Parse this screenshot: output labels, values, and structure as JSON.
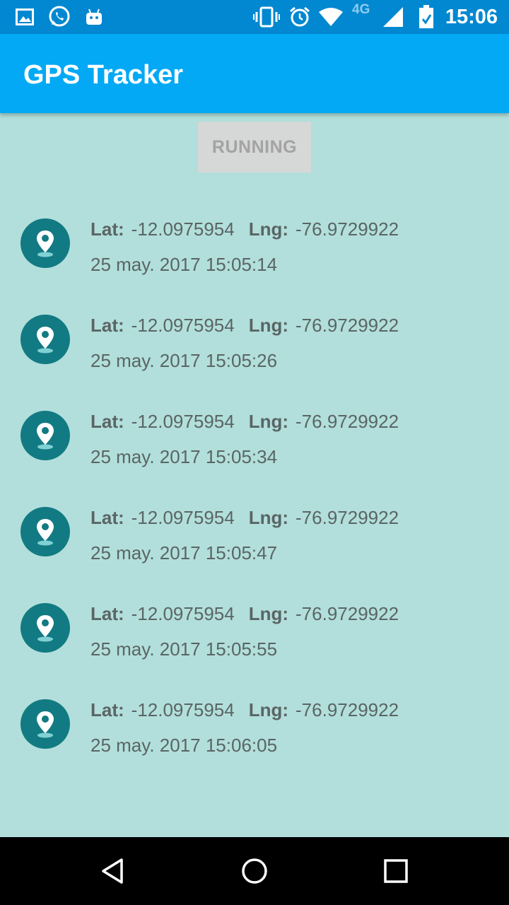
{
  "status_bar": {
    "time": "15:06",
    "network_type": "4G",
    "icons_left": [
      "gallery-icon",
      "whatsapp-icon",
      "android-icon"
    ],
    "icons_right": [
      "vibrate-icon",
      "alarm-icon",
      "wifi-icon",
      "signal-icon",
      "battery-icon"
    ]
  },
  "app_bar": {
    "title": "GPS Tracker"
  },
  "controls": {
    "running_label": "RUNNING"
  },
  "labels": {
    "lat": "Lat:",
    "lng": "Lng:"
  },
  "locations": [
    {
      "lat": "-12.0975954",
      "lng": "-76.9729922",
      "timestamp": "25 may. 2017 15:05:14"
    },
    {
      "lat": "-12.0975954",
      "lng": "-76.9729922",
      "timestamp": "25 may. 2017 15:05:26"
    },
    {
      "lat": "-12.0975954",
      "lng": "-76.9729922",
      "timestamp": "25 may. 2017 15:05:34"
    },
    {
      "lat": "-12.0975954",
      "lng": "-76.9729922",
      "timestamp": "25 may. 2017 15:05:47"
    },
    {
      "lat": "-12.0975954",
      "lng": "-76.9729922",
      "timestamp": "25 may. 2017 15:05:55"
    },
    {
      "lat": "-12.0975954",
      "lng": "-76.9729922",
      "timestamp": "25 may. 2017 15:06:05"
    }
  ],
  "colors": {
    "status_bar": "#0288d1",
    "app_bar": "#03a9f4",
    "background": "#b2dfdb",
    "icon_circle": "#127a83",
    "text": "#5a6565"
  }
}
